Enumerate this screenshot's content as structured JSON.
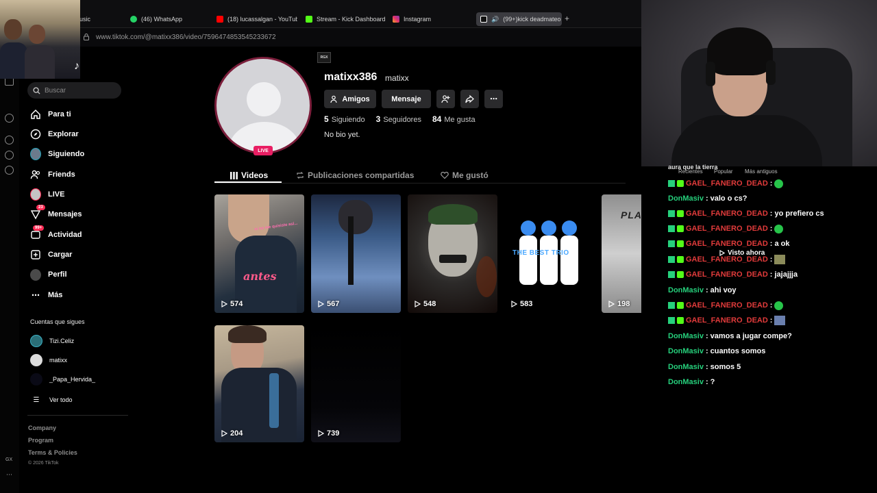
{
  "browser": {
    "tabs": [
      {
        "label": "usic",
        "color": "#000000"
      },
      {
        "label": "(46) WhatsApp",
        "color": "#25d366"
      },
      {
        "label": "(18) lucassalgan - YouTub",
        "color": "#ff0000"
      },
      {
        "label": "Stream - Kick Dashboard",
        "color": "#53fc18"
      },
      {
        "label": "Instagram",
        "color": "#e1306c"
      },
      {
        "label": "(99+)kick deadmateo",
        "color": "#ffffff"
      }
    ],
    "new_tab": "+",
    "url": "www.tiktok.com/@matixx386/video/7596474853545233672",
    "gx_label": "GX",
    "more": "⋯"
  },
  "sidebar": {
    "search_placeholder": "Buscar",
    "items": [
      {
        "label": "Para ti",
        "icon": "home-icon"
      },
      {
        "label": "Explorar",
        "icon": "compass-icon"
      },
      {
        "label": "Siguiendo",
        "icon": "following-avatar-icon"
      },
      {
        "label": "Friends",
        "icon": "friends-icon"
      },
      {
        "label": "LIVE",
        "icon": "live-icon"
      },
      {
        "label": "Mensajes",
        "icon": "messages-icon",
        "badge": "23"
      },
      {
        "label": "Actividad",
        "icon": "activity-icon",
        "badge": "99+"
      },
      {
        "label": "Cargar",
        "icon": "upload-icon"
      },
      {
        "label": "Perfil",
        "icon": "profile-icon"
      },
      {
        "label": "Más",
        "icon": "more-icon"
      }
    ],
    "following_title": "Cuentas que sigues",
    "following": [
      {
        "name": "Tizi.Celiz",
        "color": "#2b6f78"
      },
      {
        "name": "matixx",
        "color": "#dcdcdc"
      },
      {
        "name": "_Papa_Hervida_",
        "color": "#0a0a16"
      }
    ],
    "see_all": "Ver todo",
    "footer": [
      "Company",
      "Program",
      "Terms & Policies"
    ],
    "copyright": "© 2026 TikTok"
  },
  "profile": {
    "rgx_badge": "RGX",
    "live_label": "LIVE",
    "username": "matixx386",
    "nickname": "matixx",
    "buttons": {
      "friends": "Amigos",
      "message": "Mensaje"
    },
    "stats": [
      {
        "value": "5",
        "label": "Siguiendo"
      },
      {
        "value": "3",
        "label": "Seguidores"
      },
      {
        "value": "84",
        "label": "Me gusta"
      }
    ],
    "bio": "No bio yet.",
    "tabs": [
      "Videos",
      "Publicaciones compartidas",
      "Me gustó"
    ]
  },
  "videos": [
    {
      "views": "574",
      "caption": "antes",
      "subcaption": "si no me quisiste así..."
    },
    {
      "views": "567"
    },
    {
      "views": "548"
    },
    {
      "views": "583",
      "caption": "THE BEST TRIO"
    },
    {
      "views": "198",
      "caption": "PLAYER"
    },
    {
      "views": "204"
    },
    {
      "views": "739"
    }
  ],
  "chat": {
    "top_text": "aura que la tierra",
    "sort_tabs": [
      "Recientes",
      "Popular",
      "Más antiguos"
    ],
    "viewed_label": "Visto ahora",
    "messages": [
      {
        "user": "GAEL_FANERO_DEAD",
        "text": "",
        "emote": "green"
      },
      {
        "user": "DonMasiv",
        "text": "valo o cs?"
      },
      {
        "user": "GAEL_FANERO_DEAD",
        "text": "yo prefiero cs"
      },
      {
        "user": "GAEL_FANERO_DEAD",
        "text": "",
        "emote": "green"
      },
      {
        "user": "GAEL_FANERO_DEAD",
        "text": "a ok"
      },
      {
        "user": "GAEL_FANERO_DEAD",
        "text": "",
        "emote": "square"
      },
      {
        "user": "GAEL_FANERO_DEAD",
        "text": "jajajjja"
      },
      {
        "user": "DonMasiv",
        "text": "ahi voy"
      },
      {
        "user": "GAEL_FANERO_DEAD",
        "text": "",
        "emote": "green"
      },
      {
        "user": "GAEL_FANERO_DEAD",
        "text": "",
        "emote": "square2"
      },
      {
        "user": "DonMasiv",
        "text": "vamos a jugar compe?"
      },
      {
        "user": "DonMasiv",
        "text": "cuantos somos"
      },
      {
        "user": "DonMasiv",
        "text": "somos 5"
      },
      {
        "user": "DonMasiv",
        "text": "?"
      }
    ]
  },
  "colors": {
    "accent": "#fe2c55",
    "kick_red": "#e23b3b",
    "kick_green": "#26d07c"
  }
}
